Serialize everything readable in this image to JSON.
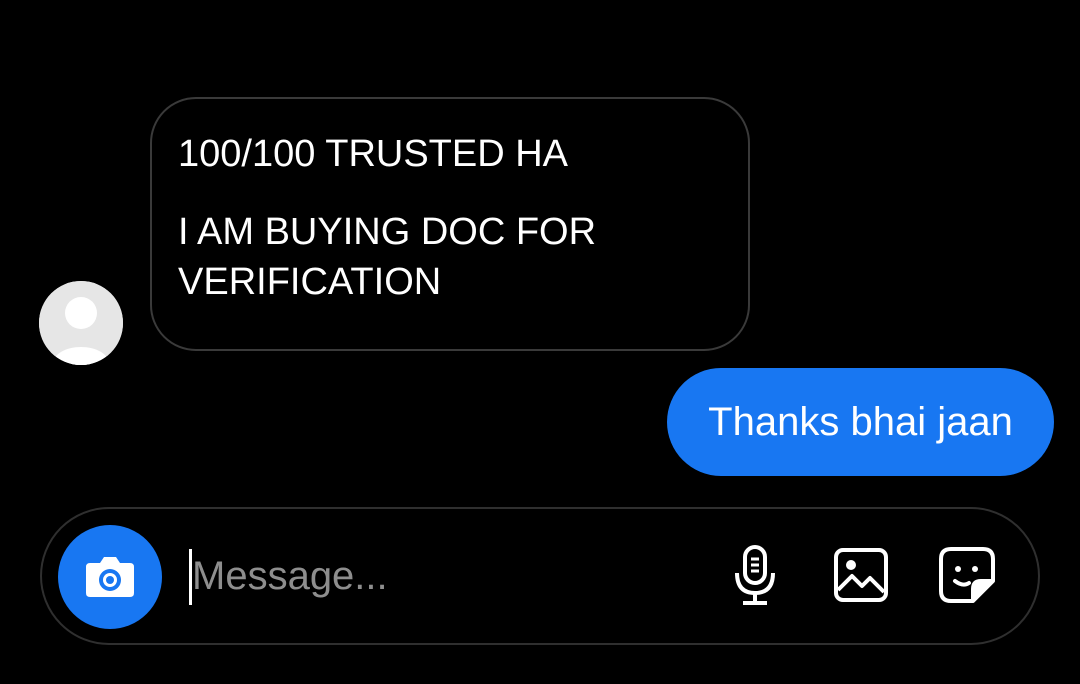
{
  "conversation": {
    "received": {
      "avatar_icon": "default-user-avatar-icon",
      "lines": [
        "100/100 TRUSTED HA",
        "I AM BUYING DOC FOR\nVERIFICATION"
      ]
    },
    "sent": {
      "text": "Thanks bhai jaan"
    }
  },
  "composer": {
    "placeholder": "Message...",
    "value": "",
    "icons": {
      "camera": "camera-icon",
      "microphone": "microphone-icon",
      "gallery": "image-gallery-icon",
      "sticker": "sticker-icon"
    }
  },
  "colors": {
    "background": "#000000",
    "accent": "#1877f2",
    "bubble_border": "#3a3a3a",
    "placeholder": "#8e8e8e"
  }
}
